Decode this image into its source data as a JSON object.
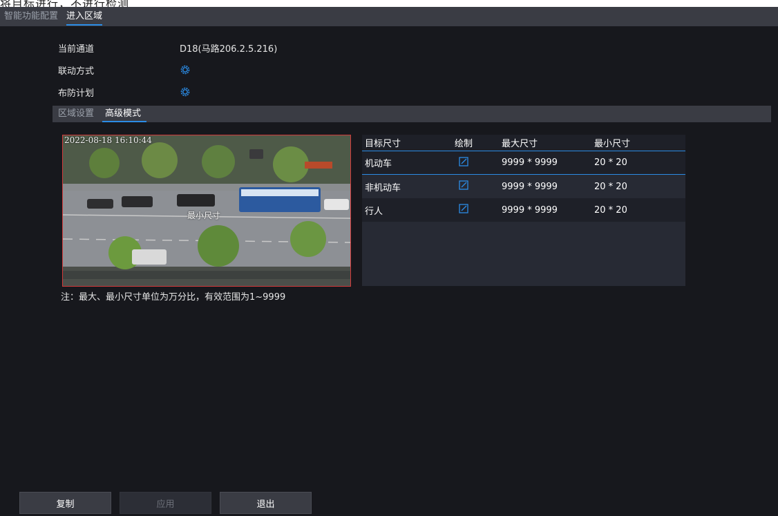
{
  "caption": "将目标进行，不进行检测",
  "top_tabs": [
    {
      "label": "智能功能配置"
    },
    {
      "label": "进入区域"
    }
  ],
  "form": {
    "channel_label": "当前通道",
    "channel_value": "D18(马路206.2.5.216)",
    "linkage_label": "联动方式",
    "schedule_label": "布防计划"
  },
  "sub_tabs": [
    {
      "label": "区域设置"
    },
    {
      "label": "高级模式"
    }
  ],
  "video": {
    "timestamp": "2022-08-18 16:10:44",
    "zone_label": "最小尺寸"
  },
  "note": "注：最大、最小尺寸单位为万分比，有效范围为1~9999",
  "table": {
    "headers": [
      "目标尺寸",
      "绘制",
      "最大尺寸",
      "最小尺寸"
    ],
    "rows": [
      {
        "target": "机动车",
        "max": "9999 * 9999",
        "min": "20 * 20"
      },
      {
        "target": "非机动车",
        "max": "9999 * 9999",
        "min": "20 * 20"
      },
      {
        "target": "行人",
        "max": "9999 * 9999",
        "min": "20 * 20"
      }
    ]
  },
  "buttons": {
    "copy": "复制",
    "apply": "应用",
    "exit": "退出"
  },
  "colors": {
    "accent": "#2b8ce6",
    "background": "#17181d",
    "tab_bar": "#3a3c44",
    "zone_border": "#d23a3a"
  },
  "icons": {
    "linkage": "gear-icon",
    "schedule": "gear-icon",
    "draw": "edit-icon"
  }
}
